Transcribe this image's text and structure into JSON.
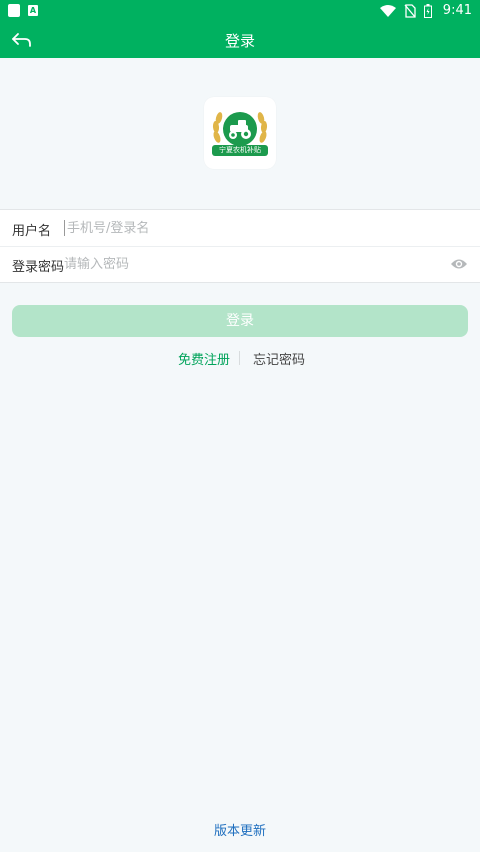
{
  "status_bar": {
    "time": "9:41"
  },
  "app_bar": {
    "title": "登录"
  },
  "logo": {
    "text": "宁夏农机补贴"
  },
  "form": {
    "username": {
      "label": "用户名",
      "placeholder": "手机号/登录名"
    },
    "password": {
      "label": "登录密码",
      "placeholder": "请输入密码"
    }
  },
  "login_button": "登录",
  "links": {
    "register": "免费注册",
    "forgot": "忘记密码"
  },
  "version_update": "版本更新",
  "colors": {
    "primary": "#00b160",
    "button_disabled": "#b3e4c9",
    "link_blue": "#1f6fbf"
  }
}
